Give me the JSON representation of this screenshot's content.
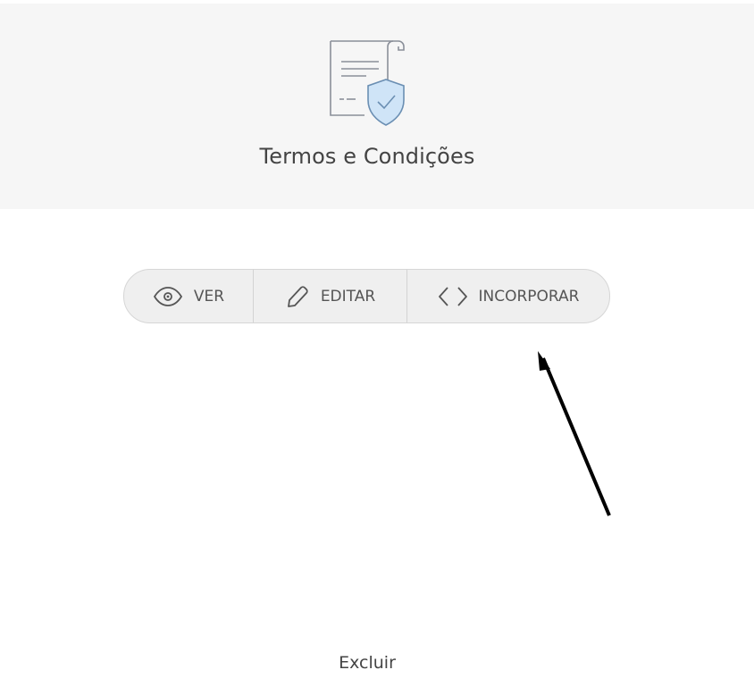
{
  "header": {
    "title": "Termos e Condições",
    "icon": "document-shield-icon"
  },
  "actions": {
    "view": {
      "label": "VER",
      "icon": "eye-icon"
    },
    "edit": {
      "label": "EDITAR",
      "icon": "pencil-icon"
    },
    "embed": {
      "label": "INCORPORAR",
      "icon": "code-brackets-icon"
    }
  },
  "annotation": {
    "type": "arrow",
    "points_to": "embed-button"
  },
  "footer": {
    "delete_label": "Excluir"
  },
  "colors": {
    "header_bg": "#f6f6f6",
    "button_group_bg": "#efefef",
    "text": "#444444",
    "shield_fill": "#cfe4f7",
    "shield_stroke": "#6b8fb3"
  }
}
